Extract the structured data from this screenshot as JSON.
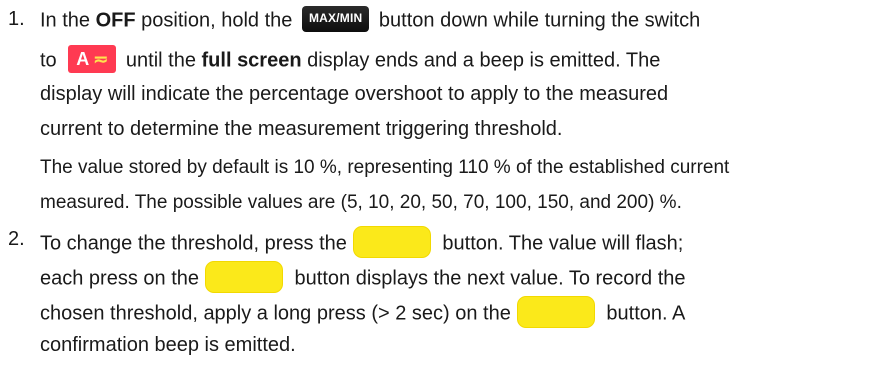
{
  "items": [
    {
      "number": "1.",
      "lines": [
        {
          "a": "In the ",
          "b_bold": "OFF",
          "c": " position, hold the ",
          "key": "MAX/MIN",
          "d": " button down while turning the switch"
        },
        {
          "a": "to ",
          "key_letter": "A",
          "key_symbol": "≂",
          "b": " until the ",
          "c_bold": "full screen",
          "d": " display ends and a beep is emitted. The"
        },
        {
          "text": "display will indicate the percentage overshoot to apply to the measured"
        },
        {
          "text": "current to determine the measurement triggering threshold."
        },
        {
          "text": "The value stored by default is 10 %, representing 110 % of the established current"
        },
        {
          "text": "measured. The possible values are (5, 10, 20, 50, 70, 100, 150, and 200) %."
        }
      ]
    },
    {
      "number": "2.",
      "lines": [
        {
          "a": "To change the threshold, press the",
          "b": " button. The value will flash;"
        },
        {
          "a": "each press on the",
          "b": " button displays the next value. To record the"
        },
        {
          "a": "chosen threshold, apply a long press (> 2 sec) on the",
          "b": " button. A"
        },
        {
          "text": "confirmation beep is emitted."
        }
      ]
    }
  ],
  "colors": {
    "text": "#1a1a1a",
    "maxmin_key": "#111111",
    "amp_key": "#ff3a52",
    "amp_wave": "#ffe34d",
    "yellow_key": "#fbe91a"
  }
}
